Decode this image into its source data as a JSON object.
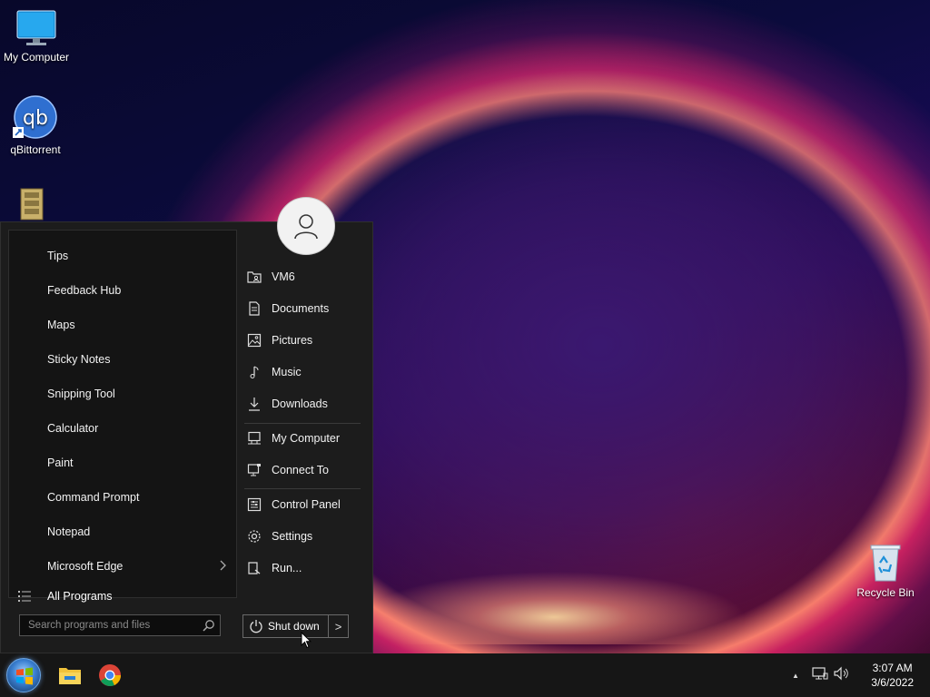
{
  "desktop": {
    "icons": [
      {
        "label": "My Computer"
      },
      {
        "label": "qBittorrent"
      },
      {
        "label": "Recycle Bin"
      }
    ],
    "qb_icon_text": "qb"
  },
  "start_menu": {
    "programs": [
      {
        "label": "Tips"
      },
      {
        "label": "Feedback Hub"
      },
      {
        "label": "Maps"
      },
      {
        "label": "Sticky Notes"
      },
      {
        "label": "Snipping Tool"
      },
      {
        "label": "Calculator"
      },
      {
        "label": "Paint"
      },
      {
        "label": "Command Prompt"
      },
      {
        "label": "Notepad"
      },
      {
        "label": "Microsoft Edge",
        "has_submenu": true
      }
    ],
    "all_programs": "All Programs",
    "search_placeholder": "Search programs and files",
    "right_items": [
      {
        "label": "VM6",
        "icon": "user-folder-icon"
      },
      {
        "label": "Documents",
        "icon": "document-icon"
      },
      {
        "label": "Pictures",
        "icon": "picture-icon"
      },
      {
        "label": "Music",
        "icon": "music-icon"
      },
      {
        "label": "Downloads",
        "icon": "download-icon"
      },
      {
        "label": "My Computer",
        "icon": "computer-icon"
      },
      {
        "label": "Connect To",
        "icon": "connect-icon"
      },
      {
        "label": "Control Panel",
        "icon": "control-panel-icon"
      },
      {
        "label": "Settings",
        "icon": "gear-icon"
      },
      {
        "label": "Run...",
        "icon": "run-icon"
      }
    ],
    "shutdown_label": "Shut down",
    "shutdown_arrow": ">"
  },
  "taskbar": {
    "pinned": [
      "file-explorer-icon",
      "chrome-icon"
    ],
    "tray_up_arrow": "▲",
    "clock": {
      "time": "3:07 AM",
      "date": "3/6/2022"
    }
  },
  "colors": {
    "menu_bg": "#1c1c1c",
    "taskbar_bg": "#161616"
  }
}
